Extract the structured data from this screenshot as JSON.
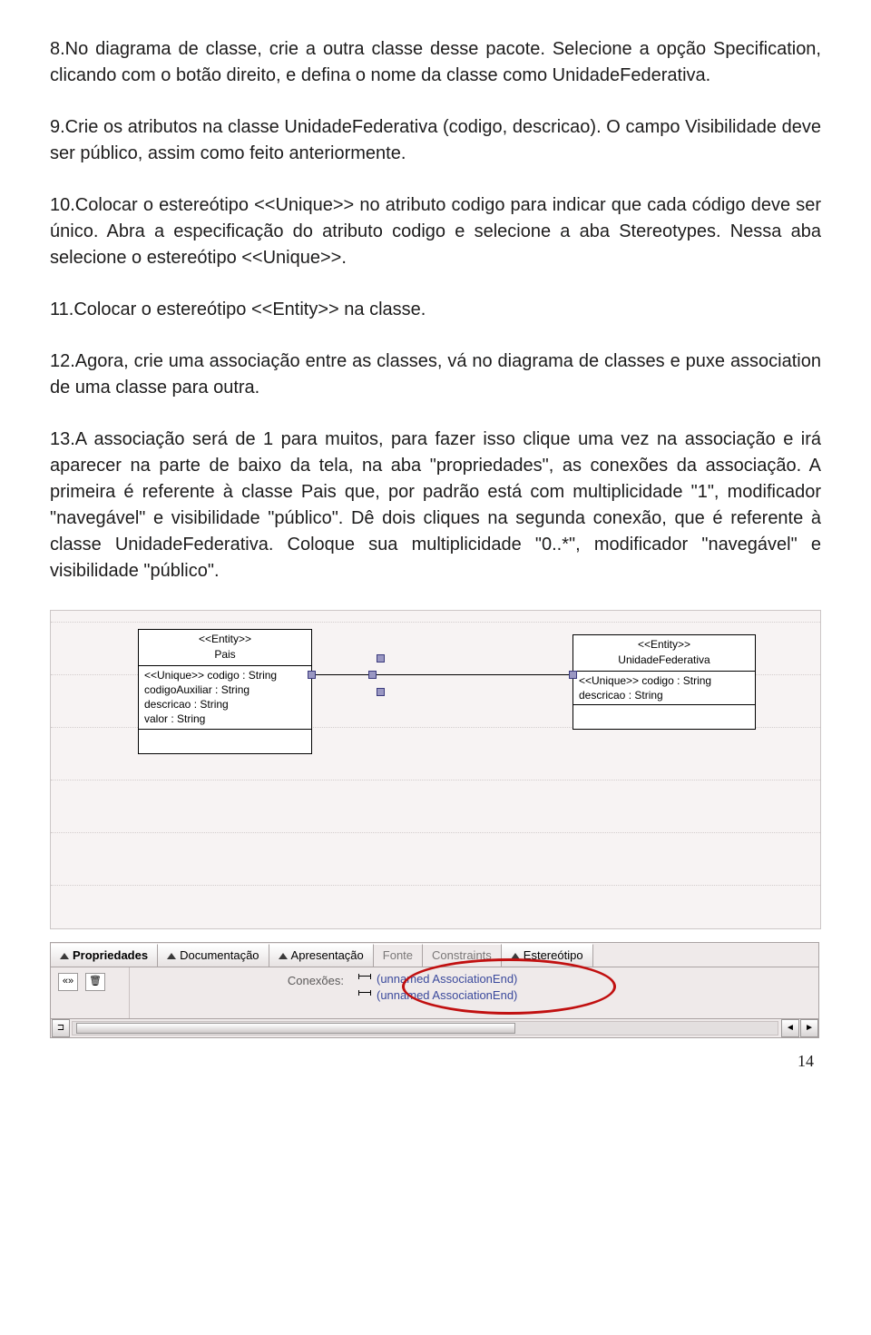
{
  "paragraphs": {
    "p1": "8.No diagrama de classe, crie a outra classe desse pacote. Selecione a opção Specification, clicando com o botão direito, e defina o nome da classe como UnidadeFederativa.",
    "p2": "9.Crie os atributos na classe UnidadeFederativa (codigo, descricao). O campo Visibilidade deve ser público, assim como feito anteriormente.",
    "p3": "10.Colocar o estereótipo <<Unique>> no atributo codigo para indicar que cada código deve ser único. Abra a especificação do atributo codigo e selecione a aba Stereotypes. Nessa aba selecione o estereótipo <<Unique>>.",
    "p4": "11.Colocar o estereótipo <<Entity>> na classe.",
    "p5": "12.Agora, crie uma associação entre as classes, vá no diagrama de classes e puxe association de uma classe para outra.",
    "p6": "13.A associação será de 1 para muitos, para fazer isso clique uma vez na associação e irá aparecer na parte de baixo da tela, na aba \"propriedades\", as conexões da associação. A primeira é referente à classe Pais que, por padrão está com multiplicidade \"1\", modificador \"navegável\" e visibilidade \"público\". Dê dois cliques na segunda conexão, que é referente  à classe UnidadeFederativa. Coloque sua multiplicidade \"0..*\", modificador \"navegável\" e visibilidade \"público\"."
  },
  "uml": {
    "class1": {
      "stereotype": "<<Entity>>",
      "name": "Pais",
      "attr1": "<<Unique>> codigo : String",
      "attr2": "codigoAuxiliar : String",
      "attr3": "descricao : String",
      "attr4": "valor : String"
    },
    "class2": {
      "stereotype": "<<Entity>>",
      "name": "UnidadeFederativa",
      "attr1": "<<Unique>> codigo : String",
      "attr2": "descricao : String"
    }
  },
  "panel": {
    "tabs": {
      "t1": "Propriedades",
      "t2": "Documentação",
      "t3": "Apresentação",
      "t4": "Fonte",
      "t5": "Constraints",
      "t6": "Estereótipo"
    },
    "left_btn1": "«»",
    "left_btn2": "🗑",
    "conex_label": "Conexões:",
    "assoc_end1": "(unnamed AssociationEnd)",
    "assoc_end2": "(unnamed AssociationEnd)",
    "scroll_left": "◄",
    "scroll_right": "◄"
  },
  "pagenum": "14"
}
